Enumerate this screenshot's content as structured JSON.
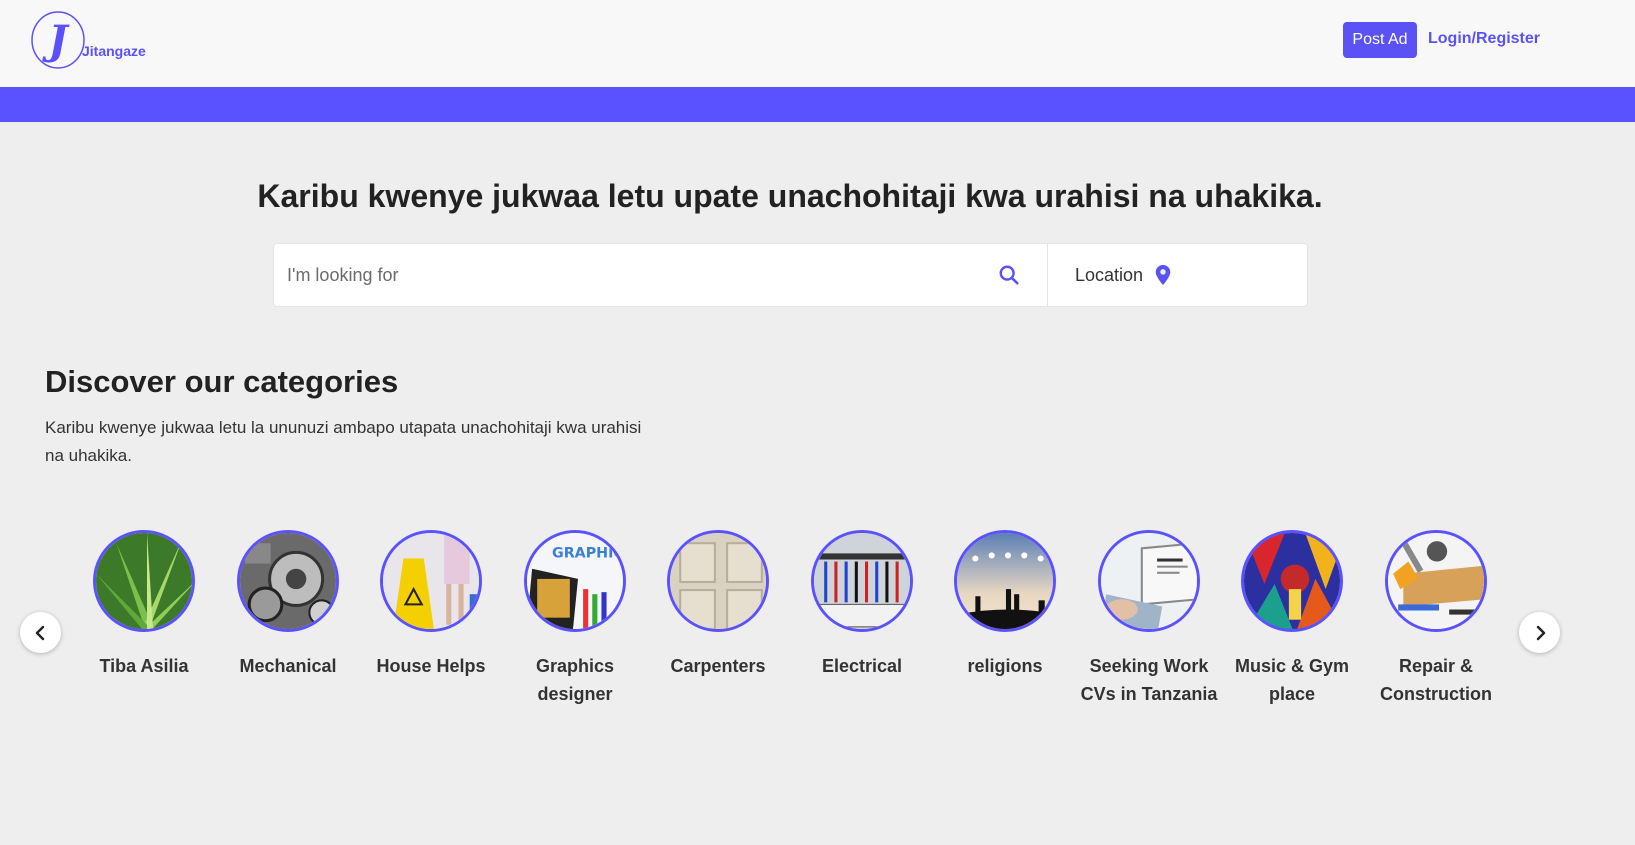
{
  "header": {
    "logo_letter": "J",
    "logo_text": "Jitangaze",
    "post_ad_label": "Post Ad",
    "login_label": "Login/Register"
  },
  "hero": {
    "title": "Karibu kwenye jukwaa letu upate unachohitaji kwa urahisi na uhakika.",
    "search_placeholder": "I'm looking for",
    "location_label": "Location"
  },
  "categories_section": {
    "title": "Discover our categories",
    "description": "Karibu kwenye jukwaa letu la ununuzi ambapo utapata unachohitaji kwa urahisi na uhakika.",
    "items": [
      {
        "label": "Tiba Asilia",
        "icon": "aloe-plant-image"
      },
      {
        "label": "Mechanical",
        "icon": "engine-image"
      },
      {
        "label": "House Helps",
        "icon": "wet-floor-sign-image"
      },
      {
        "label": "Graphics designer",
        "icon": "graphic-design-image",
        "image_text": "GRAPHIC DESIGN"
      },
      {
        "label": "Carpenters",
        "icon": "wooden-door-image"
      },
      {
        "label": "Electrical",
        "icon": "electrical-panel-image"
      },
      {
        "label": "religions",
        "icon": "religion-silhouettes-image"
      },
      {
        "label": "Seeking Work CVs in Tanzania",
        "icon": "laptop-cv-image"
      },
      {
        "label": "Music & Gym place",
        "icon": "music-art-image"
      },
      {
        "label": "Repair & Construction",
        "icon": "tools-image"
      }
    ]
  },
  "colors": {
    "accent": "#5b52ff",
    "background": "#eeeeee",
    "header_bg": "#f8f8f8"
  }
}
